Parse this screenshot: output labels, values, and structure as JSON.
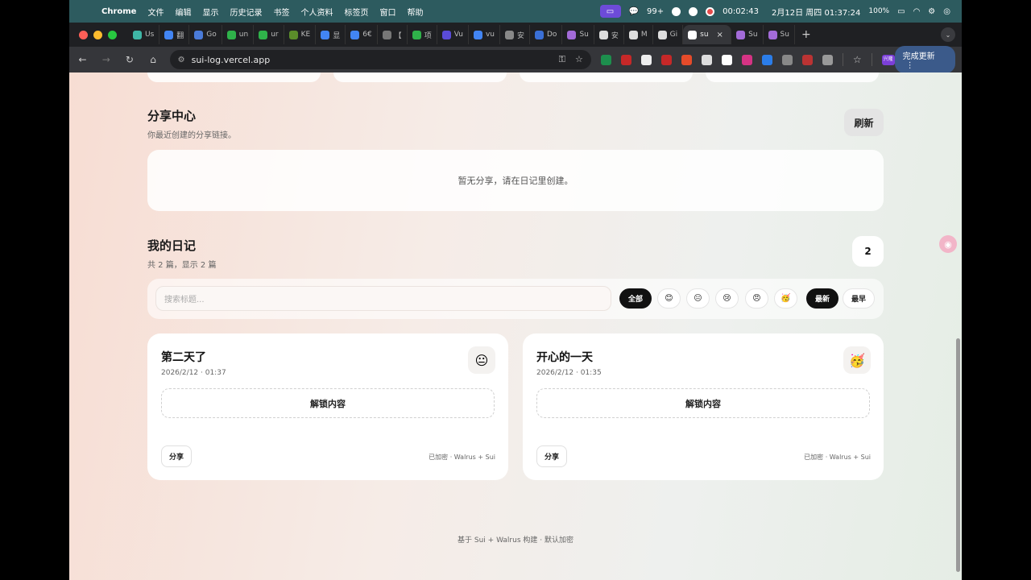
{
  "menubar": {
    "app": "Chrome",
    "items": [
      "文件",
      "编辑",
      "显示",
      "历史记录",
      "书签",
      "个人资料",
      "标签页",
      "窗口",
      "帮助"
    ],
    "wechat_badge": "99+",
    "timer": "00:02:43",
    "datetime": "2月12日 周四 01:37:24",
    "battery": "100%"
  },
  "tabs": [
    {
      "label": "Us",
      "color": "#3fb6a6"
    },
    {
      "label": "翻",
      "color": "#4285f4"
    },
    {
      "label": "Go",
      "color": "#4a7bd9"
    },
    {
      "label": "un",
      "color": "#2fb24a"
    },
    {
      "label": "ur",
      "color": "#2fb24a"
    },
    {
      "label": "KE",
      "color": "#5b8c2a"
    },
    {
      "label": "显",
      "color": "#4285f4"
    },
    {
      "label": "6€",
      "color": "#4285f4"
    },
    {
      "label": "【",
      "color": "#777777"
    },
    {
      "label": "项",
      "color": "#2fb24a"
    },
    {
      "label": "Vu",
      "color": "#5a4bd8"
    },
    {
      "label": "vu",
      "color": "#4285f4"
    },
    {
      "label": "安",
      "color": "#888888"
    },
    {
      "label": "Do",
      "color": "#3a6fd6"
    },
    {
      "label": "Su",
      "color": "#a36bd8"
    },
    {
      "label": "安",
      "color": "#dddddd"
    },
    {
      "label": "M",
      "color": "#dddddd"
    },
    {
      "label": "Gi",
      "color": "#dddddd"
    },
    {
      "label": "su",
      "color": "#ffffff"
    },
    {
      "label": "Su",
      "color": "#a36bd8"
    },
    {
      "label": "Su",
      "color": "#a36bd8"
    }
  ],
  "active_tab_label": "",
  "toolbar": {
    "url": "sui-log.vercel.app",
    "update_label": "完成更新",
    "update_icon_label": "兴隆"
  },
  "share_center": {
    "title": "分享中心",
    "subtitle": "你最近创建的分享链接。",
    "refresh_label": "刷新",
    "empty_text": "暂无分享，请在日记里创建。"
  },
  "diary": {
    "title": "我的日记",
    "subtitle": "共 2 篇，显示 2 篇",
    "count": "2",
    "search_placeholder": "搜索标题...",
    "filter_all": "全部",
    "mood_filters": [
      "😊",
      "😐",
      "😢",
      "😠",
      "🥳"
    ],
    "sort_newest": "最新",
    "sort_oldest": "最早"
  },
  "entries": [
    {
      "title": "第二天了",
      "date": "2026/2/12 · 01:37",
      "mood": "😐",
      "unlock_label": "解锁内容",
      "share_label": "分享",
      "encryption": "已加密 · Walrus + Sui"
    },
    {
      "title": "开心的一天",
      "date": "2026/2/12 · 01:35",
      "mood": "🥳",
      "unlock_label": "解锁内容",
      "share_label": "分享",
      "encryption": "已加密 · Walrus + Sui"
    }
  ],
  "footer": "基于 Sui + Walrus 构建 · 默认加密",
  "colors": {
    "menubar_bg": "#2d5b5f",
    "accent_dark": "#111111",
    "page_gradient_start": "#f7ddd3",
    "page_gradient_end": "#e5ede5"
  }
}
